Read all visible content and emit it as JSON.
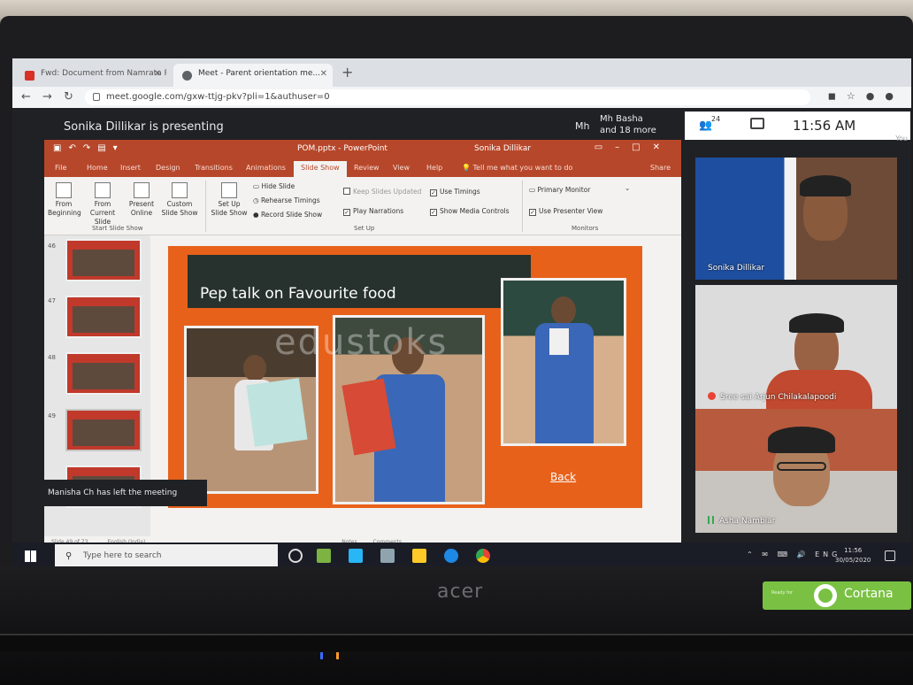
{
  "browser": {
    "tabs": [
      {
        "title": "Fwd: Document from Namrata R...",
        "favicon_color": "#d93025"
      },
      {
        "title": "Meet - Parent orientation me...",
        "favicon_color": "#5f6368"
      }
    ],
    "url": "meet.google.com/gxw-ttjg-pkv?pli=1&authuser=0"
  },
  "meet": {
    "presenting_text": "Sonika Dillikar is presenting",
    "avatar_initials": "Mh",
    "host_name": "Mh Basha",
    "more_count": "and 18 more",
    "people_count": "24",
    "time": "11:56 AM",
    "you_label": "You",
    "toast": "Manisha Ch has left the meeting",
    "participants": [
      {
        "name": "Sonika Dillikar",
        "mic": "none"
      },
      {
        "name": "Sree sai Arjun Chilakalapoodi",
        "mic": "muted"
      },
      {
        "name": "Asha Nambiar",
        "mic": "active"
      }
    ]
  },
  "powerpoint": {
    "filename": "POM.pptx - PowerPoint",
    "user": "Sonika Dillikar",
    "tabs": [
      "File",
      "Home",
      "Insert",
      "Design",
      "Transitions",
      "Animations",
      "Slide Show",
      "Review",
      "View",
      "Help"
    ],
    "active_tab": "Slide Show",
    "tell_me": "Tell me what you want to do",
    "share": "Share",
    "ribbon": {
      "from_beginning": "From Beginning",
      "from_current": "From Current Slide",
      "present_online": "Present Online",
      "custom_show": "Custom Slide Show",
      "group1": "Start Slide Show",
      "set_up": "Set Up Slide Show",
      "hide_slide": "Hide Slide",
      "rehearse": "Rehearse Timings",
      "record": "Record Slide Show",
      "keep_updated": "Keep Slides Updated",
      "use_timings": "Use Timings",
      "play_narrations": "Play Narrations",
      "media_controls": "Show Media Controls",
      "group2": "Set Up",
      "primary_monitor": "Primary Monitor",
      "presenter_view": "Use Presenter View",
      "group3": "Monitors"
    },
    "slide_numbers": [
      "46",
      "47",
      "48",
      "49"
    ],
    "slide": {
      "title": "Pep talk on Favourite food",
      "back_link": "Back",
      "watermark": "edustoks"
    },
    "status_left": "Slide 49 of 73",
    "status_lang": "English (India)",
    "status_notes": "Notes",
    "status_comments": "Comments"
  },
  "taskbar": {
    "search_placeholder": "Type here to search",
    "lang": "ENG",
    "time": "11:56",
    "date": "30/05/2020"
  },
  "laptop": {
    "brand": "acer",
    "sticker_ready": "Ready for",
    "sticker_word": "Cortana"
  }
}
